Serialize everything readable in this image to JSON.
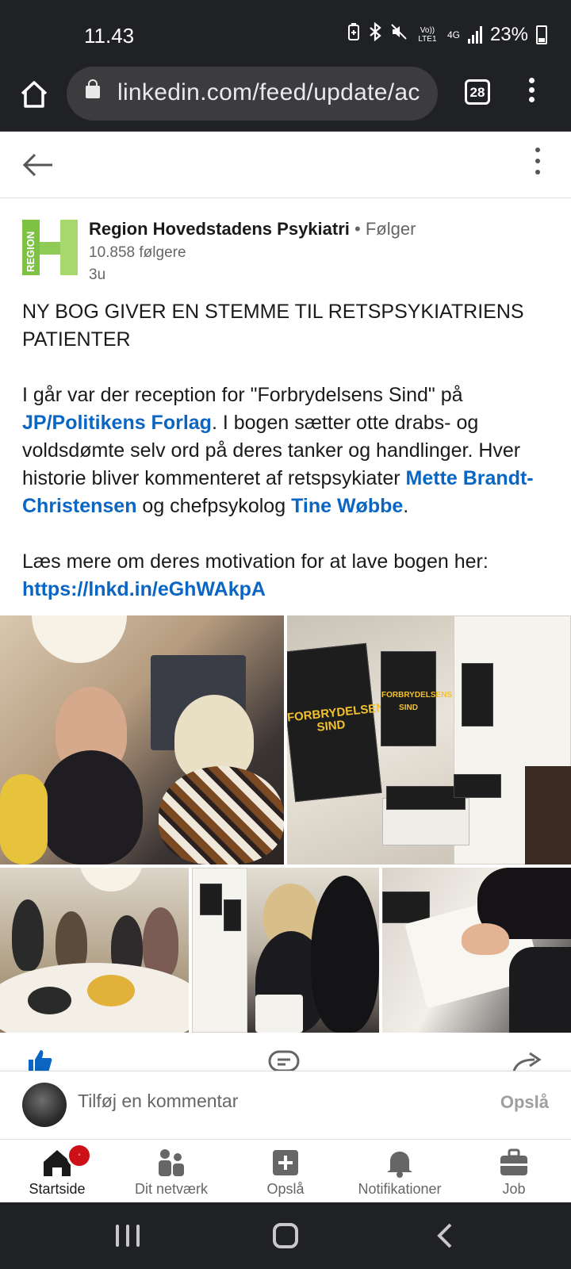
{
  "status_bar": {
    "time": "11.43",
    "network_label": "Vo)) LTE1",
    "network_type": "4G",
    "battery": "23%"
  },
  "browser": {
    "url": "linkedin.com/feed/update/ac",
    "tab_count": "28",
    "icons": [
      "home-icon",
      "lock-icon",
      "tabs-icon",
      "menu-icon"
    ]
  },
  "app_header": {
    "icons": [
      "back-arrow-icon",
      "more-vertical-icon"
    ]
  },
  "post": {
    "author": "Region Hovedstadens Psykiatri",
    "follow_state": "• Følger",
    "followers": "10.858 følgere",
    "time": "3u",
    "logo_text": "REGION",
    "logo_colors": {
      "green": "#7dc242",
      "light_green": "#a7d86e"
    },
    "headline": "NY BOG GIVER EN STEMME TIL RETSPSYKIATRIENS PATIENTER",
    "p2": {
      "t1": "I går var der reception for \"Forbrydelsens Sind\" på ",
      "link1": "JP/Politikens Forlag",
      "t2": ". I bogen sætter otte drabs- og voldsdømte selv ord på deres tanker og handlinger. Hver historie bliver kommenteret af retspsykiater ",
      "link2": "Mette Brandt-Christensen",
      "t3": " og chefpsykolog ",
      "link3": "Tine Wøbbe",
      "t4": "."
    },
    "p3": {
      "t1": "Læs mere om deres motivation for at lave bogen her: ",
      "link": "https://lnkd.in/eGhWAkpA"
    },
    "book_cover_title": "FORBRYDELSENS SIND"
  },
  "comment_bar": {
    "placeholder": "Tilføj en kommentar",
    "post_label": "Opslå"
  },
  "bottom_nav": {
    "items": [
      {
        "label": "Startside",
        "icon": "home-icon",
        "active": true,
        "badge": "◦"
      },
      {
        "label": "Dit netværk",
        "icon": "network-icon"
      },
      {
        "label": "Opslå",
        "icon": "plus-square-icon"
      },
      {
        "label": "Notifikationer",
        "icon": "bell-icon"
      },
      {
        "label": "Job",
        "icon": "briefcase-icon"
      }
    ]
  },
  "colors": {
    "link": "#0a66c2",
    "badge": "#cc1016",
    "system_bar": "#202124",
    "like_blue": "#0a66c2"
  }
}
